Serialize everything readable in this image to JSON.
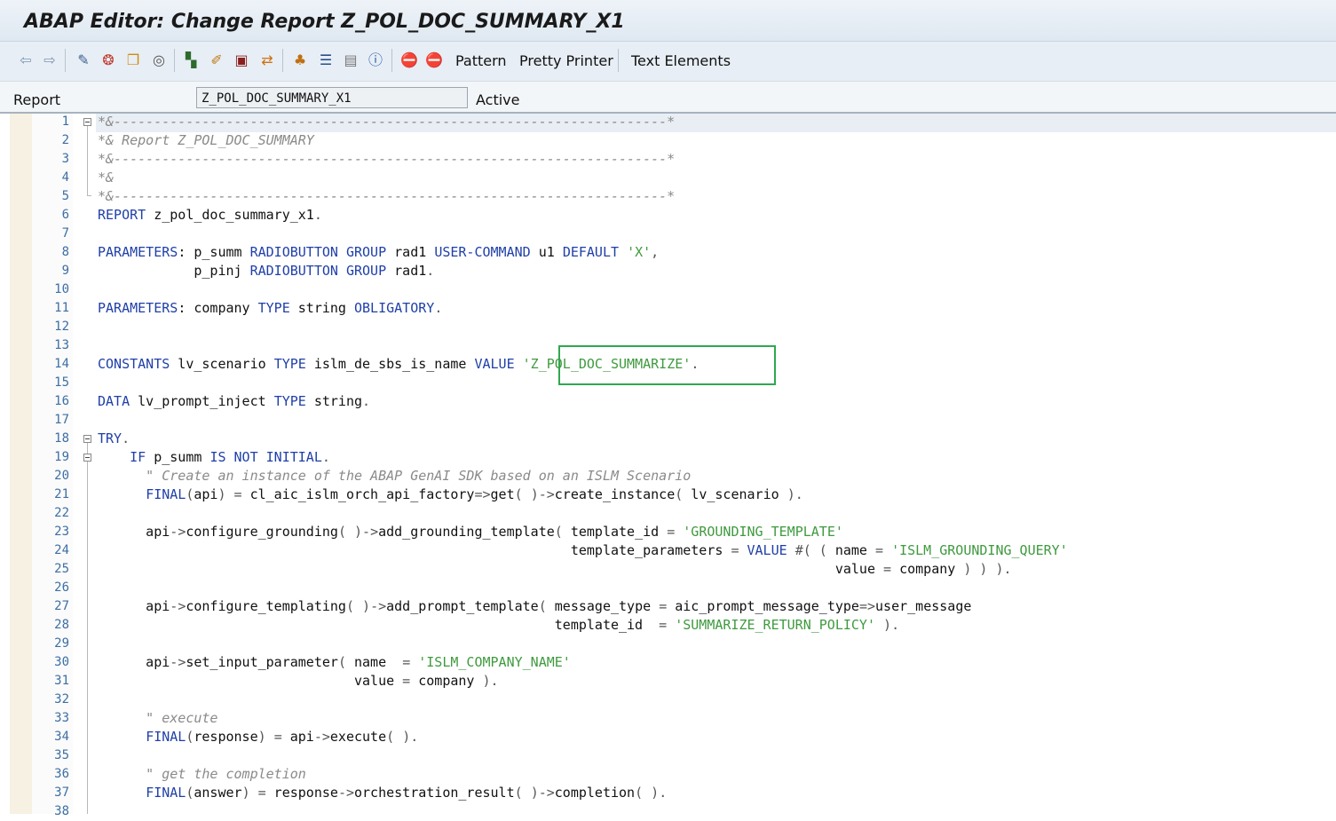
{
  "window": {
    "title": "ABAP Editor: Change Report Z_POL_DOC_SUMMARY_X1"
  },
  "toolbar": {
    "icons": [
      "back-arrow-icon",
      "forward-arrow-icon",
      "display-change-icon",
      "activate-icon",
      "copy-icon",
      "where-used-icon",
      "other-object-icon",
      "check-syntax-icon",
      "display-object-list-icon",
      "navigation-window-icon",
      "object-list-icon",
      "hierarchy-icon",
      "outline-icon",
      "block-icon",
      "info-icon",
      "breakpoint-icon",
      "session-breakpoint-icon"
    ],
    "pattern_label": "Pattern",
    "pretty_printer_label": "Pretty Printer",
    "text_elements_label": "Text Elements"
  },
  "header": {
    "report_label": "Report",
    "report_value": "Z_POL_DOC_SUMMARY_X1",
    "status": "Active"
  },
  "code": {
    "lines": [
      "*&---------------------------------------------------------------------*",
      "*& Report Z_POL_DOC_SUMMARY",
      "*&---------------------------------------------------------------------*",
      "*&",
      "*&---------------------------------------------------------------------*",
      "REPORT z_pol_doc_summary_x1.",
      "",
      "PARAMETERS: p_summ RADIOBUTTON GROUP rad1 USER-COMMAND u1 DEFAULT 'X',",
      "            p_pinj RADIOBUTTON GROUP rad1.",
      "",
      "PARAMETERS: company TYPE string OBLIGATORY.",
      "",
      "",
      "CONSTANTS lv_scenario TYPE islm_de_sbs_is_name VALUE 'Z_POL_DOC_SUMMARIZE'.",
      "",
      "DATA lv_prompt_inject TYPE string.",
      "",
      "TRY.",
      "    IF p_summ IS NOT INITIAL.",
      "      \" Create an instance of the ABAP GenAI SDK based on an ISLM Scenario",
      "      FINAL(api) = cl_aic_islm_orch_api_factory=>get( )->create_instance( lv_scenario ).",
      "",
      "      api->configure_grounding( )->add_grounding_template( template_id = 'GROUNDING_TEMPLATE'",
      "                                                           template_parameters = VALUE #( ( name = 'ISLM_GROUNDING_QUERY'",
      "                                                                                            value = company ) ) ).",
      "",
      "      api->configure_templating( )->add_prompt_template( message_type = aic_prompt_message_type=>user_message",
      "                                                         template_id  = 'SUMMARIZE_RETURN_POLICY' ).",
      "",
      "      api->set_input_parameter( name  = 'ISLM_COMPANY_NAME'",
      "                                value = company ).",
      "",
      "      \" execute",
      "      FINAL(response) = api->execute( ).",
      "",
      "      \" get the completion",
      "      FINAL(answer) = response->orchestration_result( )->completion( ).",
      ""
    ],
    "line_numbers": [
      "1",
      "2",
      "3",
      "4",
      "5",
      "6",
      "7",
      "8",
      "9",
      "10",
      "11",
      "12",
      "13",
      "14",
      "15",
      "16",
      "17",
      "18",
      "19",
      "20",
      "21",
      "22",
      "23",
      "24",
      "25",
      "26",
      "27",
      "28",
      "29",
      "30",
      "31",
      "32",
      "33",
      "34",
      "35",
      "36",
      "37",
      "38"
    ]
  }
}
